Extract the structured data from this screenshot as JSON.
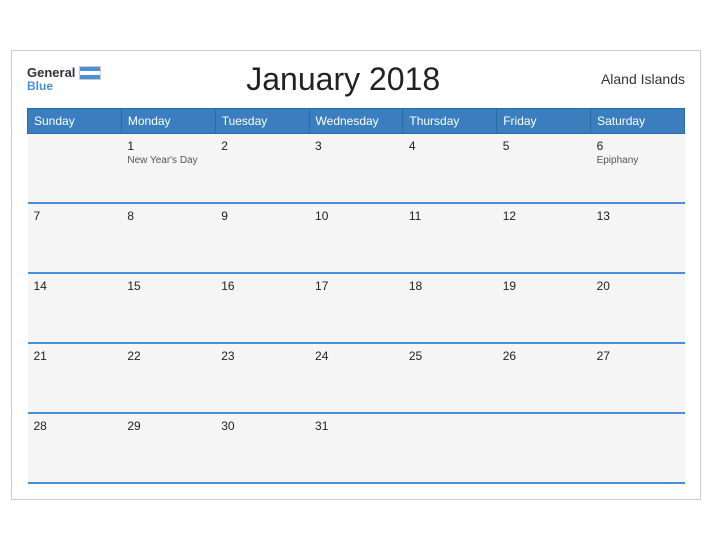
{
  "header": {
    "logo_general": "General",
    "logo_blue": "Blue",
    "title": "January 2018",
    "region": "Aland Islands"
  },
  "weekdays": [
    "Sunday",
    "Monday",
    "Tuesday",
    "Wednesday",
    "Thursday",
    "Friday",
    "Saturday"
  ],
  "weeks": [
    [
      {
        "day": "",
        "holiday": ""
      },
      {
        "day": "1",
        "holiday": "New Year's Day"
      },
      {
        "day": "2",
        "holiday": ""
      },
      {
        "day": "3",
        "holiday": ""
      },
      {
        "day": "4",
        "holiday": ""
      },
      {
        "day": "5",
        "holiday": ""
      },
      {
        "day": "6",
        "holiday": "Epiphany"
      }
    ],
    [
      {
        "day": "7",
        "holiday": ""
      },
      {
        "day": "8",
        "holiday": ""
      },
      {
        "day": "9",
        "holiday": ""
      },
      {
        "day": "10",
        "holiday": ""
      },
      {
        "day": "11",
        "holiday": ""
      },
      {
        "day": "12",
        "holiday": ""
      },
      {
        "day": "13",
        "holiday": ""
      }
    ],
    [
      {
        "day": "14",
        "holiday": ""
      },
      {
        "day": "15",
        "holiday": ""
      },
      {
        "day": "16",
        "holiday": ""
      },
      {
        "day": "17",
        "holiday": ""
      },
      {
        "day": "18",
        "holiday": ""
      },
      {
        "day": "19",
        "holiday": ""
      },
      {
        "day": "20",
        "holiday": ""
      }
    ],
    [
      {
        "day": "21",
        "holiday": ""
      },
      {
        "day": "22",
        "holiday": ""
      },
      {
        "day": "23",
        "holiday": ""
      },
      {
        "day": "24",
        "holiday": ""
      },
      {
        "day": "25",
        "holiday": ""
      },
      {
        "day": "26",
        "holiday": ""
      },
      {
        "day": "27",
        "holiday": ""
      }
    ],
    [
      {
        "day": "28",
        "holiday": ""
      },
      {
        "day": "29",
        "holiday": ""
      },
      {
        "day": "30",
        "holiday": ""
      },
      {
        "day": "31",
        "holiday": ""
      },
      {
        "day": "",
        "holiday": ""
      },
      {
        "day": "",
        "holiday": ""
      },
      {
        "day": "",
        "holiday": ""
      }
    ]
  ]
}
